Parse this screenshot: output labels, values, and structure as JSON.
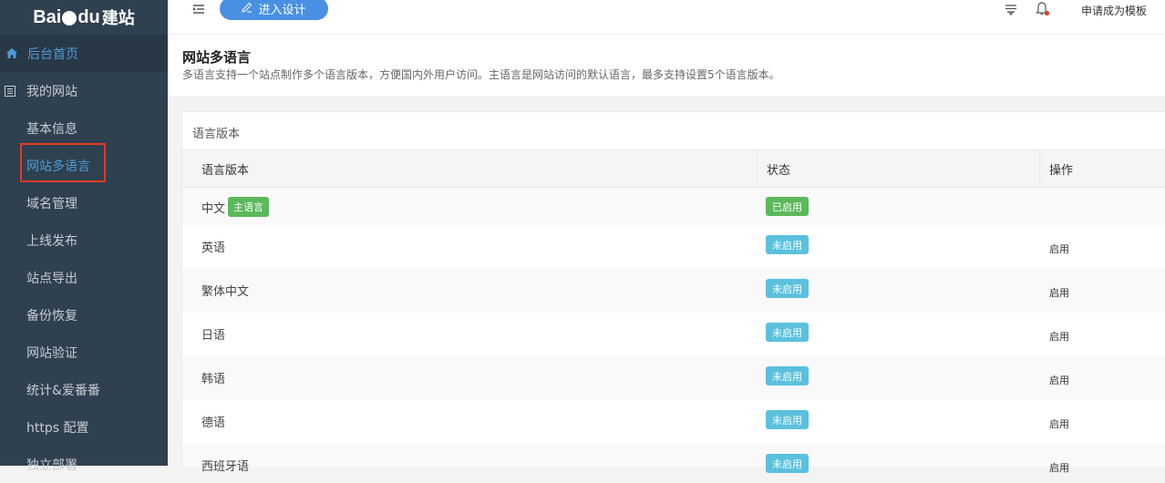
{
  "brand": {
    "logo_main": "Bai",
    "logo_mid": "du",
    "logo_sub": "建站"
  },
  "sidebar": {
    "home": "后台首页",
    "section": "我的网站",
    "items": [
      {
        "label": "基本信息"
      },
      {
        "label": "网站多语言"
      },
      {
        "label": "域名管理"
      },
      {
        "label": "上线发布"
      },
      {
        "label": "站点导出"
      },
      {
        "label": "备份恢复"
      },
      {
        "label": "网站验证"
      },
      {
        "label": "统计&爱番番"
      },
      {
        "label": "https 配置"
      },
      {
        "label": "独立部署"
      }
    ]
  },
  "topbar": {
    "design_button": "进入设计",
    "apply_template": "申请成为模板"
  },
  "page": {
    "title": "网站多语言",
    "description": "多语言支持一个站点制作多个语言版本，方便国内外用户访问。主语言是网站访问的默认语言，最多支持设置5个语言版本。"
  },
  "card": {
    "title": "语言版本",
    "columns": [
      "语言版本",
      "状态",
      "操作"
    ],
    "rows": [
      {
        "name": "中文",
        "badge": "主语言",
        "status": "已启用",
        "action": ""
      },
      {
        "name": "英语",
        "status": "未启用",
        "action": "启用"
      },
      {
        "name": "繁体中文",
        "status": "未启用",
        "action": "启用"
      },
      {
        "name": "日语",
        "status": "未启用",
        "action": "启用"
      },
      {
        "name": "韩语",
        "status": "未启用",
        "action": "启用"
      },
      {
        "name": "德语",
        "status": "未启用",
        "action": "启用"
      },
      {
        "name": "西班牙语",
        "status": "未启用",
        "action": "启用"
      }
    ]
  },
  "colors": {
    "sidebar_bg": "#2f4050",
    "accent_blue": "#4e9cd6",
    "badge_green": "#5cb85c",
    "badge_cyan": "#5bc0de",
    "highlight_red": "#e33a22"
  }
}
